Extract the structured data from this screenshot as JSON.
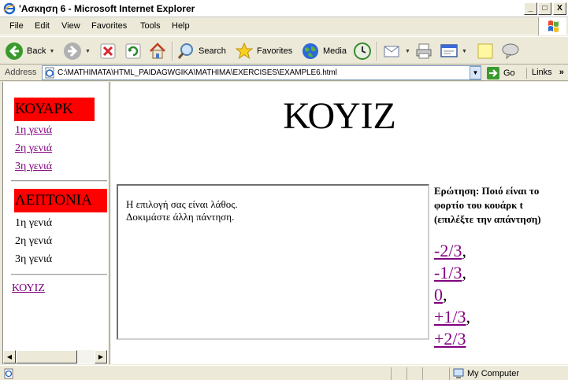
{
  "window": {
    "title": "'Ασκηση 6 - Microsoft Internet Explorer",
    "minimize": "_",
    "maximize": "□",
    "close": "X"
  },
  "menu": [
    "File",
    "Edit",
    "View",
    "Favorites",
    "Tools",
    "Help"
  ],
  "toolbar": {
    "back": "Back",
    "search": "Search",
    "favorites": "Favorites",
    "media": "Media"
  },
  "address": {
    "label": "Address",
    "value": "C:\\MATHIMATA\\HTML_PAIDAGWGIKA\\MATHIMA\\EXERCISES\\EXAMPLE6.html",
    "go": "Go",
    "links": "Links"
  },
  "nav": {
    "quarks_heading": "ΚΟΥΑΡΚ",
    "quark_links": [
      "1η γενιά",
      "2η γενιά",
      "3η γενιά"
    ],
    "leptons_heading": "ΛΕΠΤΟΝΙΑ",
    "lepton_items": [
      "1η γενιά",
      "2η γενιά",
      "3η γενιά"
    ],
    "quiz_link": "ΚΟΥΙΖ"
  },
  "main": {
    "title": "ΚΟΥΙΖ",
    "feedback_line1": "Η επιλογή σας είναι λάθος.",
    "feedback_line2": "Δοκιμάστε άλλη πάντηση.",
    "question": "Ερώτηση: Ποιό είναι το φορτίο του κουάρκ t (επιλέξτε την απάντηση)",
    "options": [
      "-2/3",
      "-1/3",
      "0",
      "+1/3",
      "+2/3"
    ]
  },
  "status": {
    "zone": "My Computer"
  }
}
